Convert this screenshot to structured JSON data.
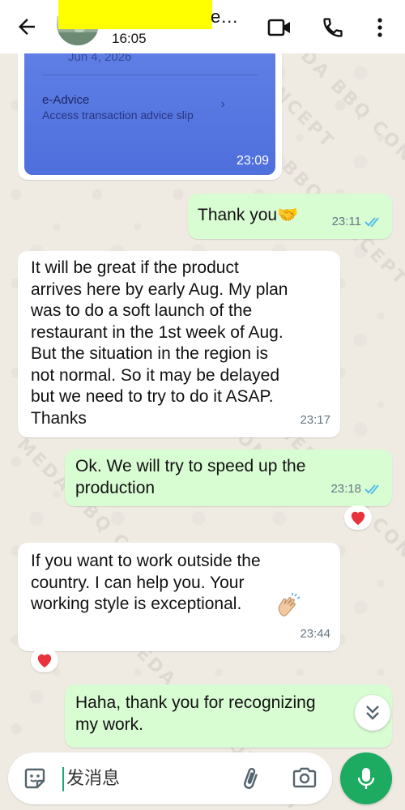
{
  "header": {
    "contact_name": "e…",
    "last_seen": "16:05",
    "accent_color": "#ffff00"
  },
  "image_message": {
    "date_text": "Jun 4, 2026",
    "title": "e-Advice",
    "subtitle": "Access transaction advice slip",
    "time": "23:09"
  },
  "messages": [
    {
      "direction": "out",
      "text": "Thank you🤝",
      "time": "23:11",
      "read": true
    },
    {
      "direction": "in",
      "text": "It will be great if the product\narrives here by early Aug. My plan\nwas to do a soft launch of the\nrestaurant in the 1st week of Aug.\nBut the situation in the region is\nnot normal. So it may be delayed\nbut we need to try to do it ASAP.\nThanks",
      "time": "23:17"
    },
    {
      "direction": "out",
      "text": "Ok. We will try to speed up the\nproduction",
      "time": "23:18",
      "read": true,
      "reaction": "heart"
    },
    {
      "direction": "in",
      "text": "If you want to work outside the\ncountry. I can help you. Your\nworking style is exceptional.",
      "emoji": "clapping-hands",
      "time": "23:44",
      "reaction": "heart"
    },
    {
      "direction": "out",
      "text": "Haha, thank you for recognizing\nmy work."
    }
  ],
  "watermark": "MEDA BBQ CONCEPT",
  "composer": {
    "placeholder": "发消息"
  },
  "colors": {
    "outgoing_bubble": "#d9fdd3",
    "incoming_bubble": "#ffffff",
    "read_ticks": "#53bdeb",
    "mic_button": "#1daa61",
    "heart": "#e8333c"
  }
}
